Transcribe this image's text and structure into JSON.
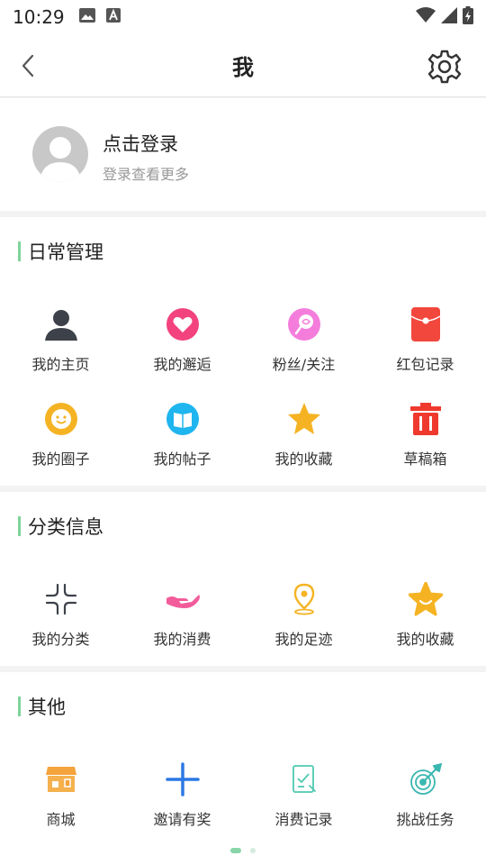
{
  "status_bar": {
    "time": "10:29"
  },
  "header": {
    "title": "我"
  },
  "profile": {
    "login_title": "点击登录",
    "login_subtitle": "登录查看更多"
  },
  "sections": [
    {
      "title": "日常管理",
      "items": [
        {
          "label": "我的主页",
          "icon": "person-icon"
        },
        {
          "label": "我的邂逅",
          "icon": "heart-icon"
        },
        {
          "label": "粉丝/关注",
          "icon": "lollipop-icon"
        },
        {
          "label": "红包记录",
          "icon": "red-envelope-icon"
        },
        {
          "label": "我的圈子",
          "icon": "smiley-icon"
        },
        {
          "label": "我的帖子",
          "icon": "book-icon"
        },
        {
          "label": "我的收藏",
          "icon": "star-icon"
        },
        {
          "label": "草稿箱",
          "icon": "trash-icon"
        }
      ]
    },
    {
      "title": "分类信息",
      "items": [
        {
          "label": "我的分类",
          "icon": "category-icon"
        },
        {
          "label": "我的消费",
          "icon": "hand-icon"
        },
        {
          "label": "我的足迹",
          "icon": "location-pin-icon"
        },
        {
          "label": "我的收藏",
          "icon": "star-badge-icon"
        }
      ]
    },
    {
      "title": "其他",
      "items": [
        {
          "label": "商城",
          "icon": "shop-icon"
        },
        {
          "label": "邀请有奖",
          "icon": "plus-icon"
        },
        {
          "label": "消费记录",
          "icon": "checklist-icon"
        },
        {
          "label": "挑战任务",
          "icon": "target-icon"
        }
      ]
    }
  ],
  "colors": {
    "accent": "#7fd39a",
    "heart": "#f2437f",
    "lollipop": "#f47ddc",
    "red_envelope": "#f2473d",
    "smiley": "#f5b323",
    "book": "#1fb5ef",
    "star": "#f5b323",
    "trash": "#f0392e",
    "person": "#3d424a",
    "hand": "#f25c9a",
    "pin": "#f5b323",
    "shop": "#f5a33c",
    "plus": "#2b78e4",
    "checklist": "#4fc9b0",
    "target": "#3ab7b0"
  }
}
